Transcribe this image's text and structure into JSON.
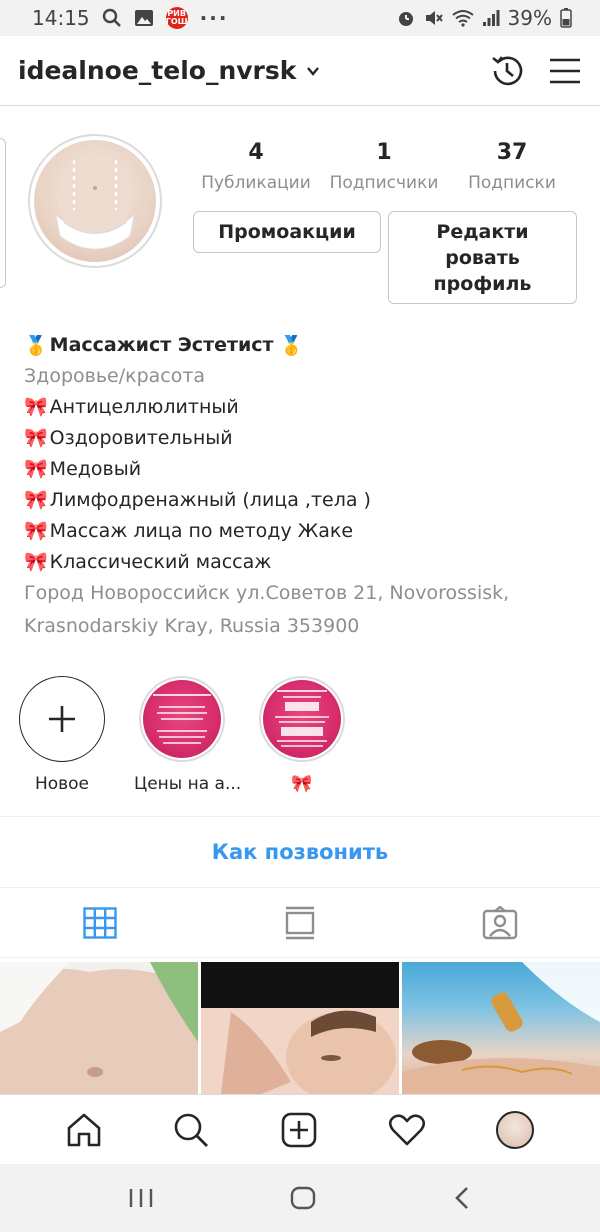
{
  "status_bar": {
    "time": "14:15",
    "notification_badge": "РИВ\nГОШ",
    "battery": "39%"
  },
  "header": {
    "username": "idealnoe_telo_nvrsk"
  },
  "profile": {
    "stats": [
      {
        "value": "4",
        "label": "Публикации"
      },
      {
        "value": "1",
        "label": "Подписчики"
      },
      {
        "value": "37",
        "label": "Подписки"
      }
    ],
    "promo_button": "Промоакции",
    "edit_button_lines": [
      "Редакти",
      "ровать",
      "профиль"
    ]
  },
  "bio": {
    "name_emoji": "🥇",
    "name": "Массажист Эстетист",
    "category": "Здоровье/красота",
    "bow_emoji": "🎀",
    "services": [
      "Антицеллюлитный",
      "Оздоровительный",
      "Медовый",
      "Лимфодренажный (лица ,тела )",
      "Массаж лица по методу Жаке",
      "Классический массаж"
    ],
    "address_lines": [
      "Город Новороссийск ул.Советов 21, Novorossisk,",
      "Krasnodarskiy Kray, Russia 353900"
    ]
  },
  "highlights": [
    {
      "label": "Новое",
      "type": "new"
    },
    {
      "label": "Цены на а...",
      "type": "story"
    },
    {
      "label": "🎀",
      "type": "story"
    }
  ],
  "call_action": "Как позвонить",
  "colors": {
    "link_blue": "#3897f0",
    "active_tab_blue": "#3897f0",
    "secondary_text": "#8e8e8e",
    "highlight_pink": "#d92e6d"
  }
}
